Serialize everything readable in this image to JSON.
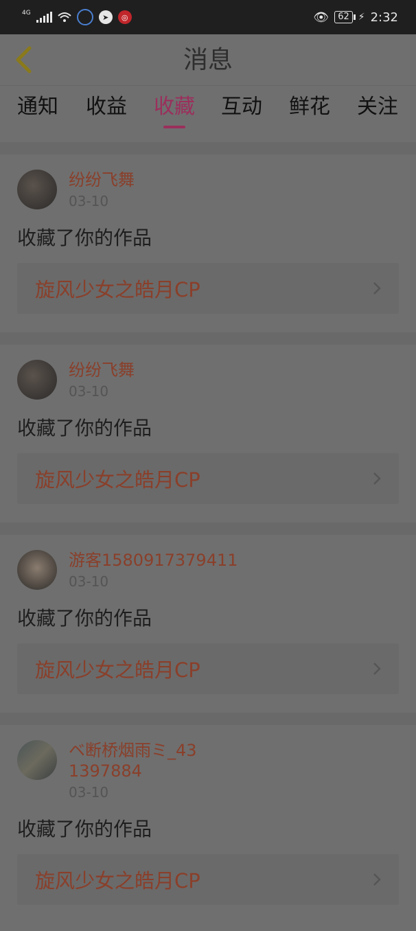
{
  "status_bar": {
    "network": "4G",
    "battery": "62",
    "time": "2:32"
  },
  "header": {
    "title": "消息"
  },
  "tabs": [
    {
      "label": "通知",
      "active": false
    },
    {
      "label": "收益",
      "active": false
    },
    {
      "label": "收藏",
      "active": true
    },
    {
      "label": "互动",
      "active": false
    },
    {
      "label": "鲜花",
      "active": false
    },
    {
      "label": "关注",
      "active": false
    }
  ],
  "messages": [
    {
      "username": "纷纷飞舞",
      "date": "03-10",
      "action": "收藏了你的作品",
      "work": "旋风少女之皓月CP"
    },
    {
      "username": "纷纷飞舞",
      "date": "03-10",
      "action": "收藏了你的作品",
      "work": "旋风少女之皓月CP"
    },
    {
      "username": "游客1580917379411",
      "date": "03-10",
      "action": "收藏了你的作品",
      "work": "旋风少女之皓月CP"
    },
    {
      "username": "ベ断桥烟雨ミ_431397884",
      "date": "03-10",
      "action": "收藏了你的作品",
      "work": "旋风少女之皓月CP"
    }
  ],
  "colors": {
    "accent": "#9b2f5c",
    "username": "#8a3f2a",
    "overlay_bg": "#6f6f6f"
  }
}
